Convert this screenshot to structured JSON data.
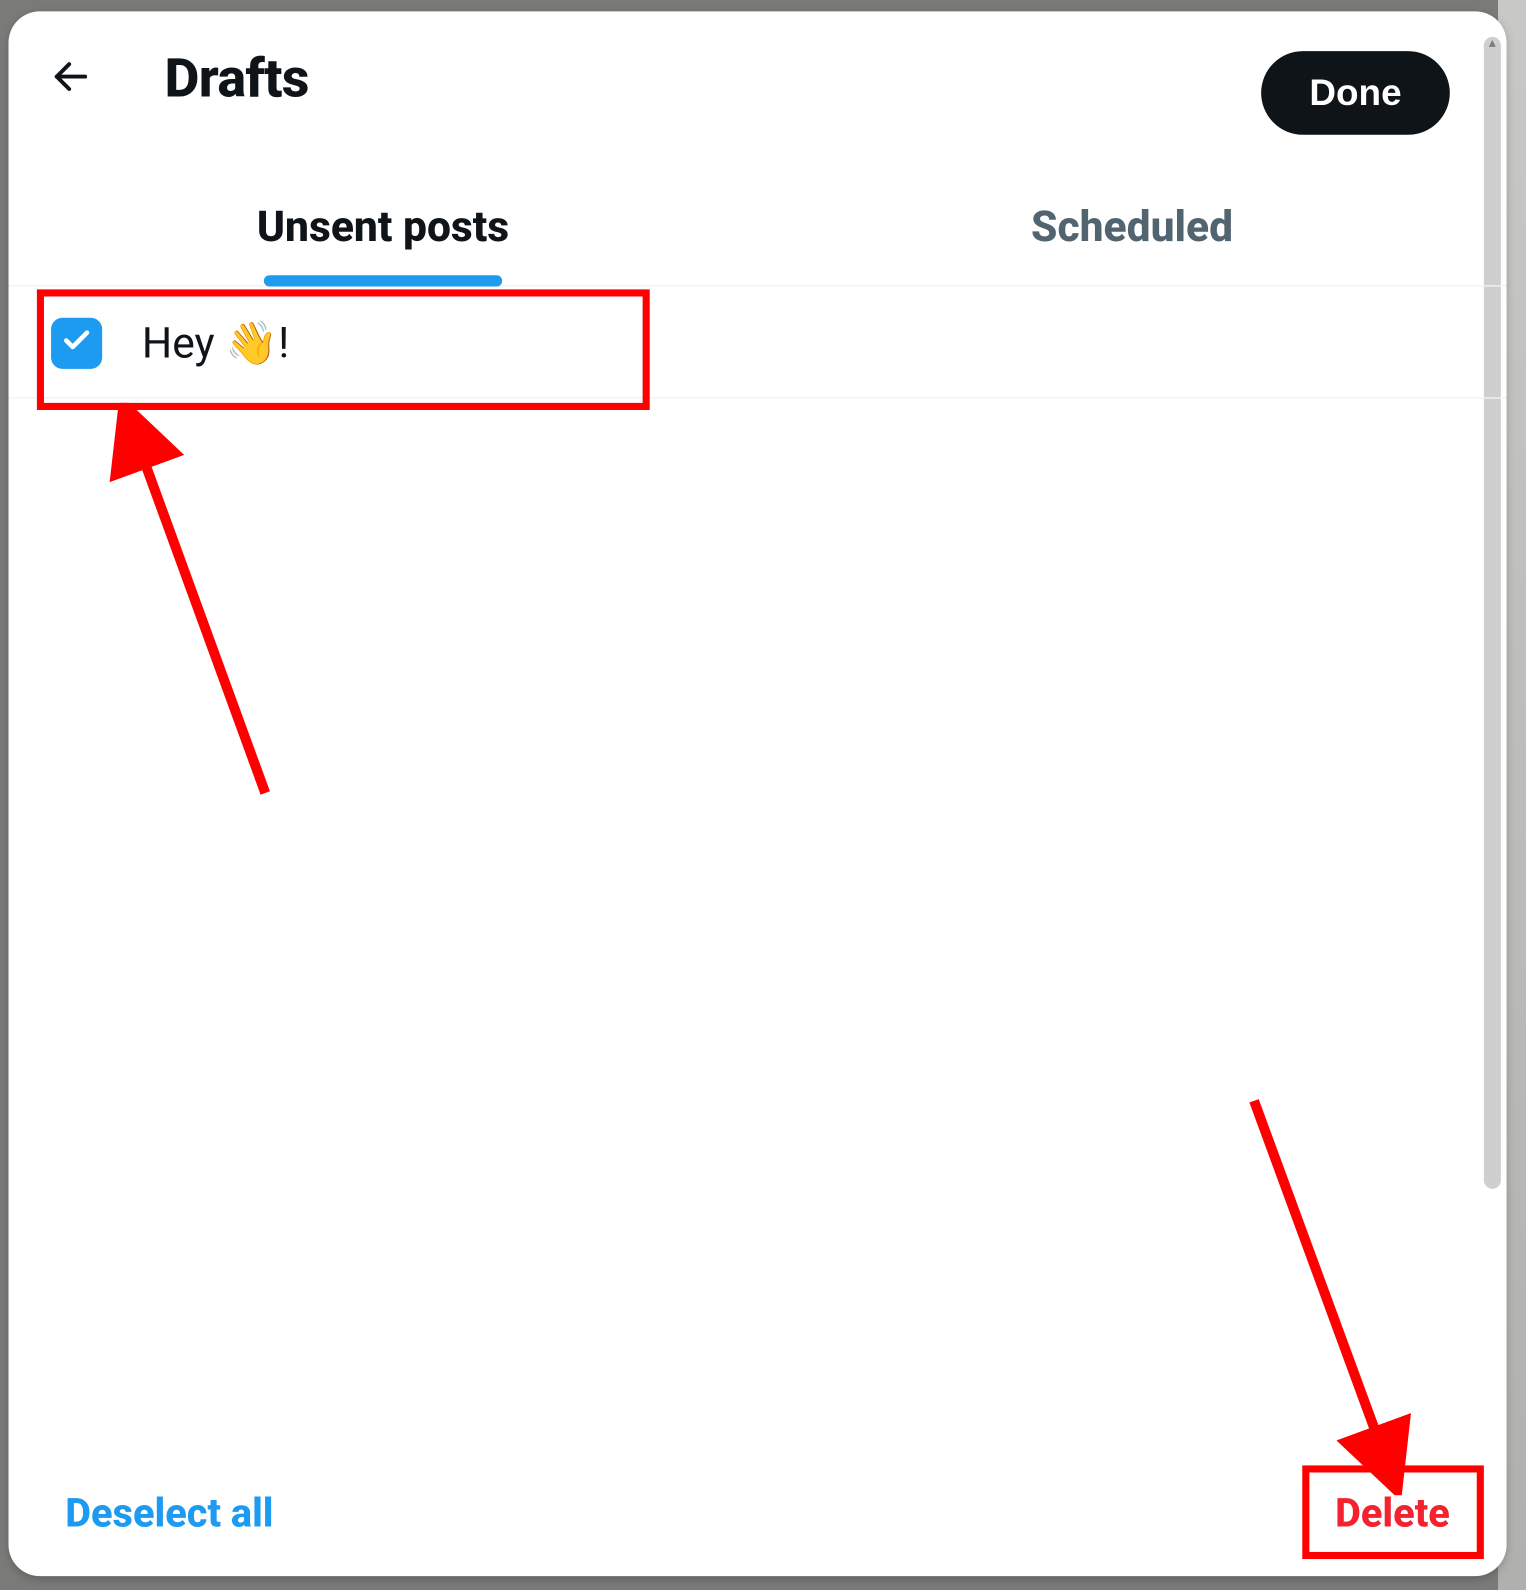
{
  "header": {
    "title": "Drafts",
    "done_label": "Done"
  },
  "tabs": {
    "unsent": {
      "label": "Unsent posts",
      "active": true
    },
    "scheduled": {
      "label": "Scheduled",
      "active": false
    }
  },
  "drafts": [
    {
      "text": "Hey 👋!",
      "checked": true
    }
  ],
  "footer": {
    "deselect_label": "Deselect all",
    "delete_label": "Delete"
  },
  "colors": {
    "accent": "#1d9bf0",
    "danger": "#f4212e",
    "text": "#0f1419",
    "muted": "#536471"
  },
  "annotations": {
    "draft_highlight": true,
    "delete_highlight": true,
    "arrow_to_draft": true,
    "arrow_to_delete": true
  }
}
